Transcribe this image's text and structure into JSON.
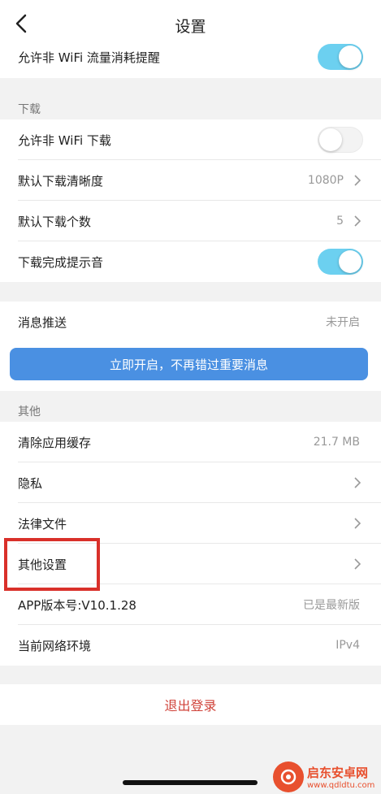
{
  "navbar": {
    "title": "设置",
    "back_icon": "chevron-left-icon"
  },
  "rows_top": {
    "allow_non_wifi_traffic": {
      "label": "允许非 WiFi 流量消耗提醒",
      "toggle": "on"
    }
  },
  "download_section": {
    "title": "下载",
    "allow_non_wifi_download": {
      "label": "允许非 WiFi 下载",
      "toggle": "off"
    },
    "default_quality": {
      "label": "默认下载清晰度",
      "value": "1080P"
    },
    "default_count": {
      "label": "默认下载个数",
      "value": "5"
    },
    "complete_sound": {
      "label": "下载完成提示音",
      "toggle": "on"
    }
  },
  "push": {
    "label": "消息推送",
    "value": "未开启",
    "enable_button": "立即开启，不再错过重要消息"
  },
  "other_section": {
    "title": "其他",
    "clear_cache": {
      "label": "清除应用缓存",
      "value": "21.7 MB"
    },
    "privacy": {
      "label": "隐私"
    },
    "legal": {
      "label": "法律文件"
    },
    "other_settings": {
      "label": "其他设置"
    },
    "app_version": {
      "label": "APP版本号:V10.1.28",
      "value": "已是最新版"
    },
    "network": {
      "label": "当前网络环境",
      "value": "IPv4"
    }
  },
  "logout": {
    "label": "退出登录"
  },
  "watermark": {
    "title": "启东安卓网",
    "url": "www.qdldtu.com"
  },
  "colors": {
    "toggle_on": "#6cd0f0",
    "promo_button": "#4a90e2",
    "logout_text": "#d0433a",
    "highlight": "#d9302a"
  }
}
